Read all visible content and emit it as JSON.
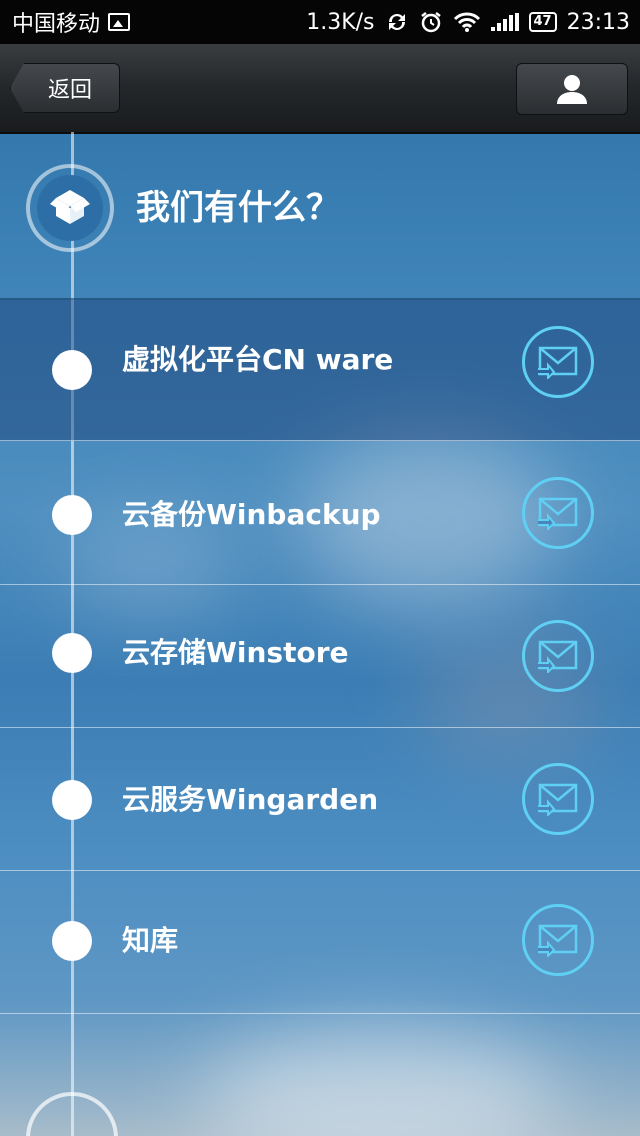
{
  "status_bar": {
    "carrier": "中国移动",
    "speed": "1.3K/s",
    "battery": "47",
    "time": "23:13"
  },
  "nav": {
    "back_label": "返回"
  },
  "header": {
    "title": "我们有什么？"
  },
  "items": [
    {
      "label": "虚拟化平台CN ware"
    },
    {
      "label": "云备份Winbackup"
    },
    {
      "label": "云存储Winstore"
    },
    {
      "label": "云服务Wingarden"
    },
    {
      "label": "知库"
    }
  ],
  "colors": {
    "accent_ring": "#5fd0f3",
    "navbar": "#24272a",
    "background": "#3f84b8"
  }
}
